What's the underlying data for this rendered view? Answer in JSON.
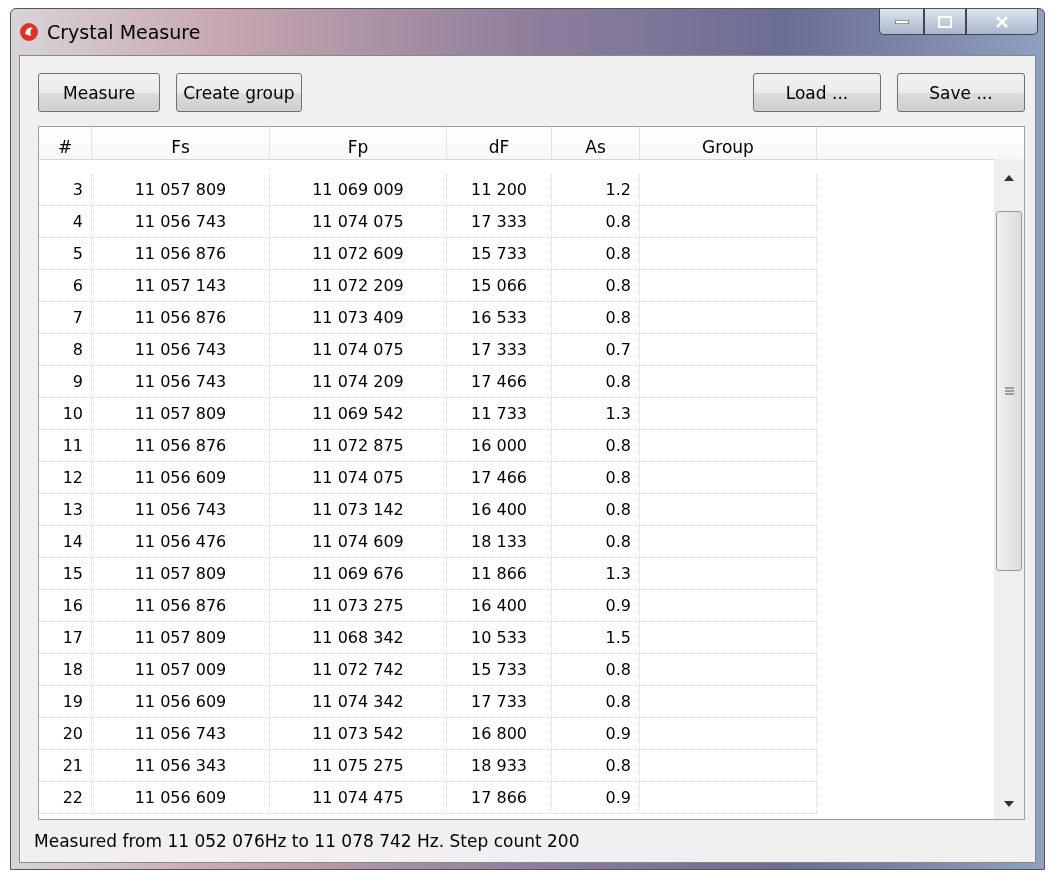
{
  "window": {
    "title": "Crystal Measure"
  },
  "toolbar": {
    "left_buttons": [
      "Measure",
      "Create group"
    ],
    "right_buttons": [
      "Load ...",
      "Save ..."
    ]
  },
  "table": {
    "columns": [
      "#",
      "Fs",
      "Fp",
      "dF",
      "As",
      "Group"
    ],
    "rows": [
      [
        "3",
        "11 057 809",
        "11 069 009",
        "11 200",
        "1.2"
      ],
      [
        "4",
        "11 056 743",
        "11 074 075",
        "17 333",
        "0.8"
      ],
      [
        "5",
        "11 056 876",
        "11 072 609",
        "15 733",
        "0.8"
      ],
      [
        "6",
        "11 057 143",
        "11 072 209",
        "15 066",
        "0.8"
      ],
      [
        "7",
        "11 056 876",
        "11 073 409",
        "16 533",
        "0.8"
      ],
      [
        "8",
        "11 056 743",
        "11 074 075",
        "17 333",
        "0.7"
      ],
      [
        "9",
        "11 056 743",
        "11 074 209",
        "17 466",
        "0.8"
      ],
      [
        "10",
        "11 057 809",
        "11 069 542",
        "11 733",
        "1.3"
      ],
      [
        "11",
        "11 056 876",
        "11 072 875",
        "16 000",
        "0.8"
      ],
      [
        "12",
        "11 056 609",
        "11 074 075",
        "17 466",
        "0.8"
      ],
      [
        "13",
        "11 056 743",
        "11 073 142",
        "16 400",
        "0.8"
      ],
      [
        "14",
        "11 056 476",
        "11 074 609",
        "18 133",
        "0.8"
      ],
      [
        "15",
        "11 057 809",
        "11 069 676",
        "11 866",
        "1.3"
      ],
      [
        "16",
        "11 056 876",
        "11 073 275",
        "16 400",
        "0.9"
      ],
      [
        "17",
        "11 057 809",
        "11 068 342",
        "10 533",
        "1.5"
      ],
      [
        "18",
        "11 057 009",
        "11 072 742",
        "15 733",
        "0.8"
      ],
      [
        "19",
        "11 056 609",
        "11 074 342",
        "17 733",
        "0.8"
      ],
      [
        "20",
        "11 056 743",
        "11 073 542",
        "16 800",
        "0.9"
      ],
      [
        "21",
        "11 056 343",
        "11 075 275",
        "18 933",
        "0.8"
      ],
      [
        "22",
        "11 056 609",
        "11 074 475",
        "17 866",
        "0.9"
      ]
    ]
  },
  "status_bar": "Measured from 11 052 076Hz to 11 078 742 Hz. Step count 200"
}
